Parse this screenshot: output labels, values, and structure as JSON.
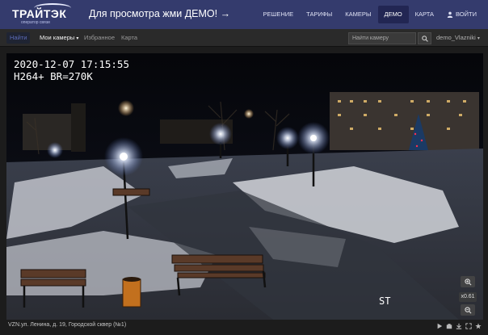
{
  "header": {
    "logo_text": "ТРАЙТЭК",
    "logo_sub": "оператор связи",
    "promo": "Для просмотра жми ДЕМО! →",
    "nav": [
      "РЕШЕНИЕ",
      "ТАРИФЫ",
      "КАМЕРЫ",
      "ДЕМО",
      "КАРТА"
    ],
    "active_nav": "ДЕМО",
    "login_label": "ВОЙТИ"
  },
  "subnav": {
    "blue_tab": "Найти",
    "my_cameras": "Мои камеры",
    "favorites": "Избранное",
    "map": "Карта",
    "search_placeholder": "Найти камеру",
    "user": "demo_Vlazniki"
  },
  "camera": {
    "osd_line1": "2020-12-07 17:15:55",
    "osd_line2": "H264+ BR=270K",
    "corner_label": "ST",
    "zoom_level": "x0.61"
  },
  "footer": {
    "caption": "VZN.ул. Ленина, д. 19, Городской сквер (№1)"
  },
  "colors": {
    "header_bg": "#343b6d",
    "active_nav_bg": "#222653"
  },
  "icons": [
    "logo-icon",
    "user-icon",
    "search-icon",
    "chevron-down-icon",
    "zoom-in-icon",
    "zoom-out-icon",
    "snapshot-icon",
    "download-icon",
    "fullscreen-icon",
    "settings-icon"
  ]
}
